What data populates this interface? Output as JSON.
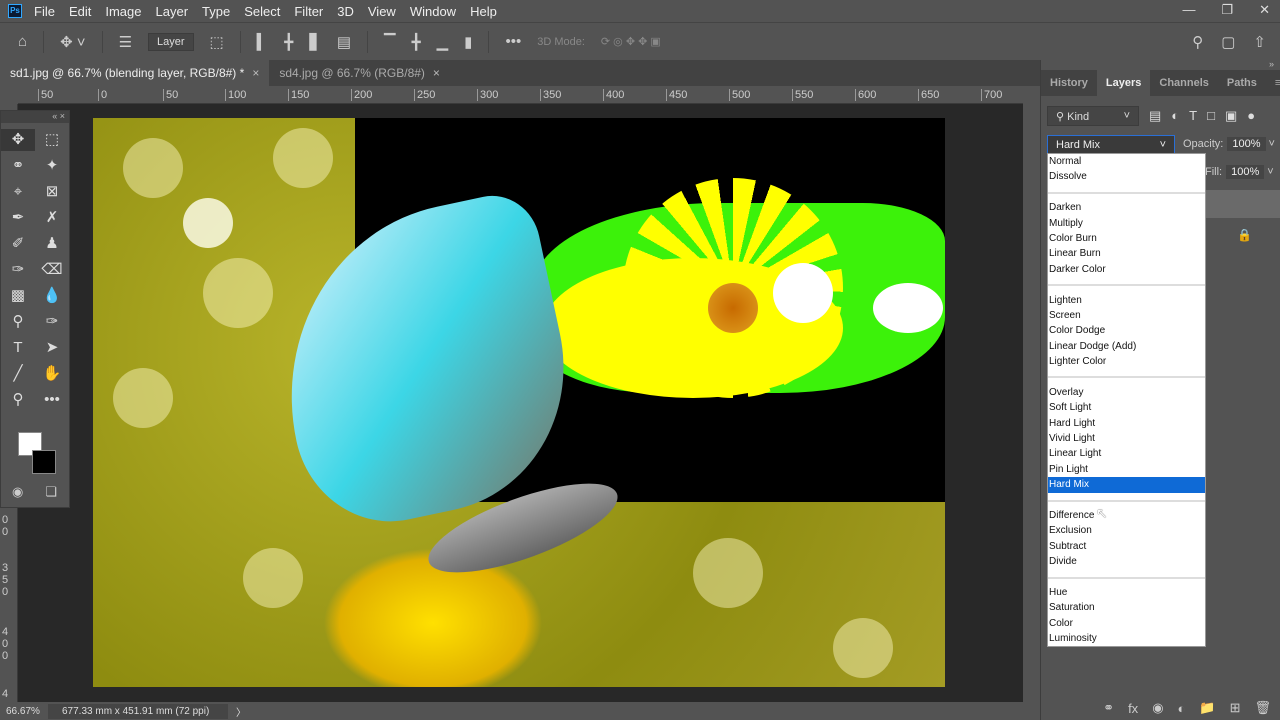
{
  "menu": [
    "File",
    "Edit",
    "Image",
    "Layer",
    "Type",
    "Select",
    "Filter",
    "3D",
    "View",
    "Window",
    "Help"
  ],
  "app_logo": "Ps",
  "options": {
    "layer_select": "Layer",
    "mode_3d": "3D Mode:"
  },
  "tabs": [
    {
      "label": "sd1.jpg @ 66.7% (blending layer, RGB/8#) *",
      "active": true
    },
    {
      "label": "sd4.jpg @ 66.7% (RGB/8#)",
      "active": false
    }
  ],
  "ruler_h": [
    "50",
    "0",
    "50",
    "100",
    "150",
    "200",
    "250",
    "300",
    "350",
    "400",
    "450",
    "500",
    "550",
    "600",
    "650",
    "700"
  ],
  "ruler_v": [
    "0 0",
    "3 5 0",
    "4 0 0",
    "4"
  ],
  "panel": {
    "tabs": [
      "History",
      "Layers",
      "Channels",
      "Paths"
    ],
    "active_tab": "Layers",
    "kind": "Kind",
    "blend_mode": "Hard Mix",
    "opacity_label": "Opacity:",
    "opacity": "100%",
    "fill_label": "Fill:",
    "fill": "100%"
  },
  "blend_modes": [
    [
      "Normal",
      "Dissolve"
    ],
    [
      "Darken",
      "Multiply",
      "Color Burn",
      "Linear Burn",
      "Darker Color"
    ],
    [
      "Lighten",
      "Screen",
      "Color Dodge",
      "Linear Dodge (Add)",
      "Lighter Color"
    ],
    [
      "Overlay",
      "Soft Light",
      "Hard Light",
      "Vivid Light",
      "Linear Light",
      "Pin Light",
      "Hard Mix"
    ],
    [
      "Difference",
      "Exclusion",
      "Subtract",
      "Divide"
    ],
    [
      "Hue",
      "Saturation",
      "Color",
      "Luminosity"
    ]
  ],
  "selected_blend": "Hard Mix",
  "status": {
    "zoom": "66.67%",
    "doc_size": "677.33 mm x 451.91 mm (72 ppi)"
  },
  "colors": {
    "accent": "#0f6ad6",
    "canvas_bg": "#282828",
    "ui_bg": "#535353"
  }
}
